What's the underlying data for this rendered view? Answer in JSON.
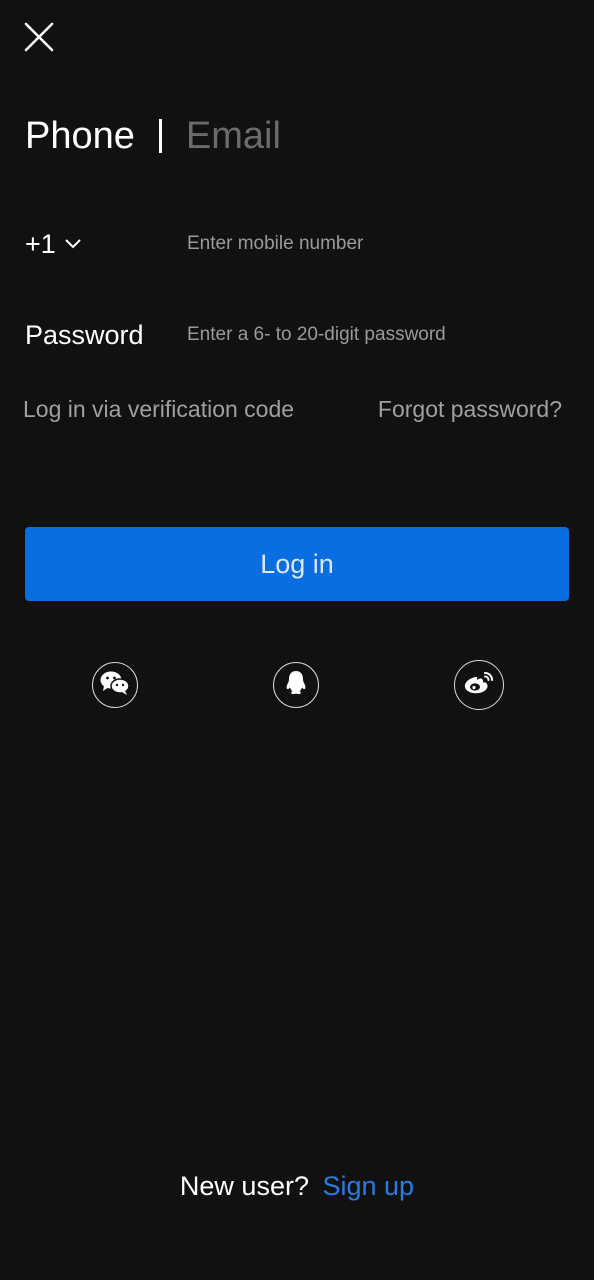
{
  "tabs": {
    "phone_label": "Phone",
    "email_label": "Email",
    "active": "phone"
  },
  "phone": {
    "country_code": "+1",
    "placeholder": "Enter mobile number",
    "value": ""
  },
  "password": {
    "label": "Password",
    "placeholder": "Enter a 6- to 20-digit password",
    "value": ""
  },
  "links": {
    "verification_code": "Log in via verification code",
    "forgot_password": "Forgot password?"
  },
  "login_button": {
    "label": "Log in"
  },
  "social": [
    {
      "icon": "wechat-icon"
    },
    {
      "icon": "qq-icon"
    },
    {
      "icon": "weibo-icon"
    }
  ],
  "signup": {
    "prompt": "New user?",
    "link": "Sign up"
  },
  "colors": {
    "background": "#111111",
    "primary": "#0b6ee0",
    "link": "#2a7bde",
    "muted_text": "#a0a0a0",
    "inactive_tab": "#6b6b6b"
  }
}
